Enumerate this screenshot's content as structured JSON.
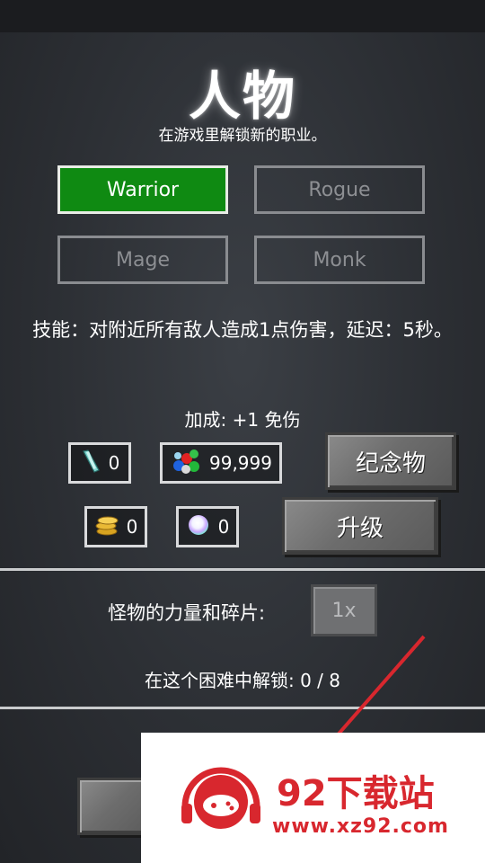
{
  "header": {
    "title": "人物",
    "subtitle": "在游戏里解锁新的职业。"
  },
  "classes": [
    {
      "label": "Warrior",
      "selected": true
    },
    {
      "label": "Rogue",
      "selected": false
    },
    {
      "label": "Mage",
      "selected": false
    },
    {
      "label": "Monk",
      "selected": false
    }
  ],
  "skill_text": "技能：对附近所有敌人造成1点伤害，延迟：5秒。",
  "bonus_text": "加成: +1 免伤",
  "resources": {
    "shard": "0",
    "gems": "99,999",
    "coins": "0",
    "orb": "0"
  },
  "buttons": {
    "relics": "纪念物",
    "upgrade": "升级"
  },
  "monster": {
    "label": "怪物的力量和碎片:",
    "multiplier": "1x"
  },
  "unlock_text": "在这个困难中解锁: 0 / 8",
  "watermark": {
    "name": "92下载站",
    "url": "www.xz92.com"
  },
  "colors": {
    "selected_class": "#0f8a12",
    "watermark_red": "#d8272e"
  }
}
